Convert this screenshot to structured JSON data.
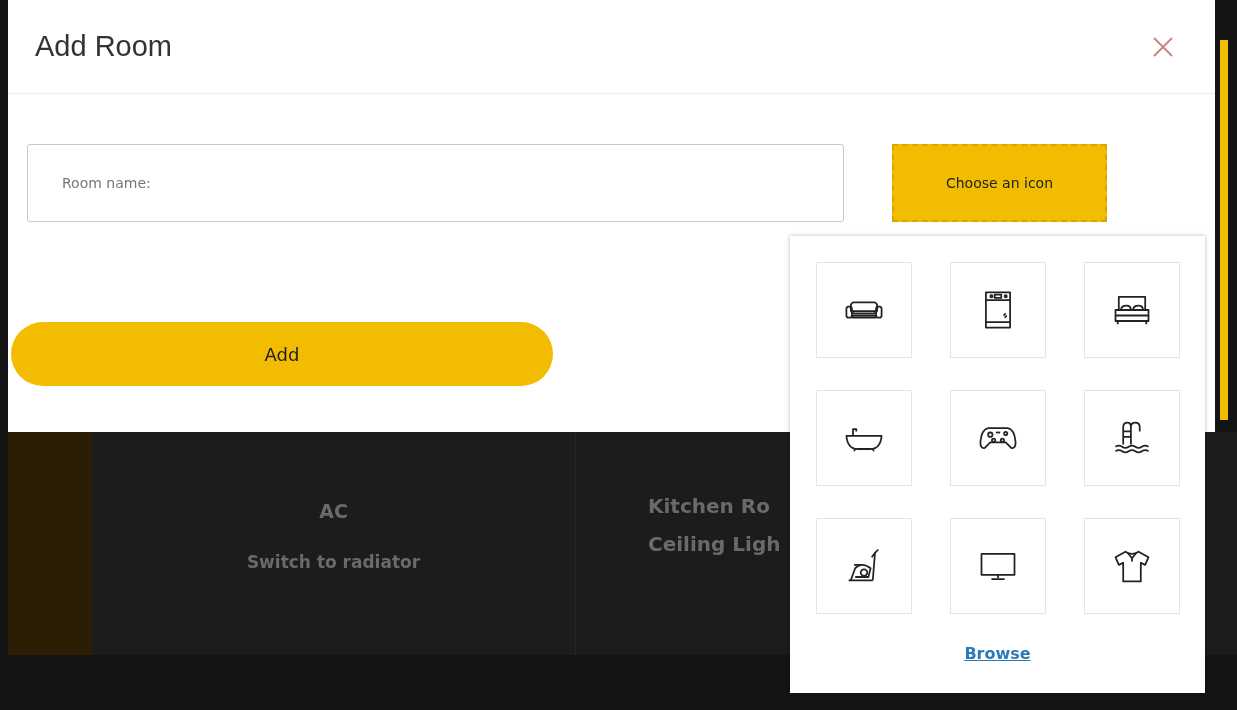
{
  "background": {
    "cards": [
      {
        "kind": "centered",
        "title": "AC",
        "subtitle": "Switch to radiator"
      },
      {
        "kind": "left",
        "title": "Kitchen Ro",
        "subtitle": "Ceiling Ligh"
      }
    ]
  },
  "dialog": {
    "title": "Add Room",
    "room_name": {
      "placeholder": "Room name:"
    },
    "choose_icon_button": "Choose an icon",
    "add_button": "Add"
  },
  "icon_picker": {
    "icons": [
      {
        "kind": "sofa"
      },
      {
        "kind": "oven"
      },
      {
        "kind": "bed"
      },
      {
        "kind": "bathtub"
      },
      {
        "kind": "gamepad"
      },
      {
        "kind": "pool"
      },
      {
        "kind": "bike"
      },
      {
        "kind": "tv"
      },
      {
        "kind": "shirt"
      }
    ],
    "browse_link": "Browse"
  }
}
